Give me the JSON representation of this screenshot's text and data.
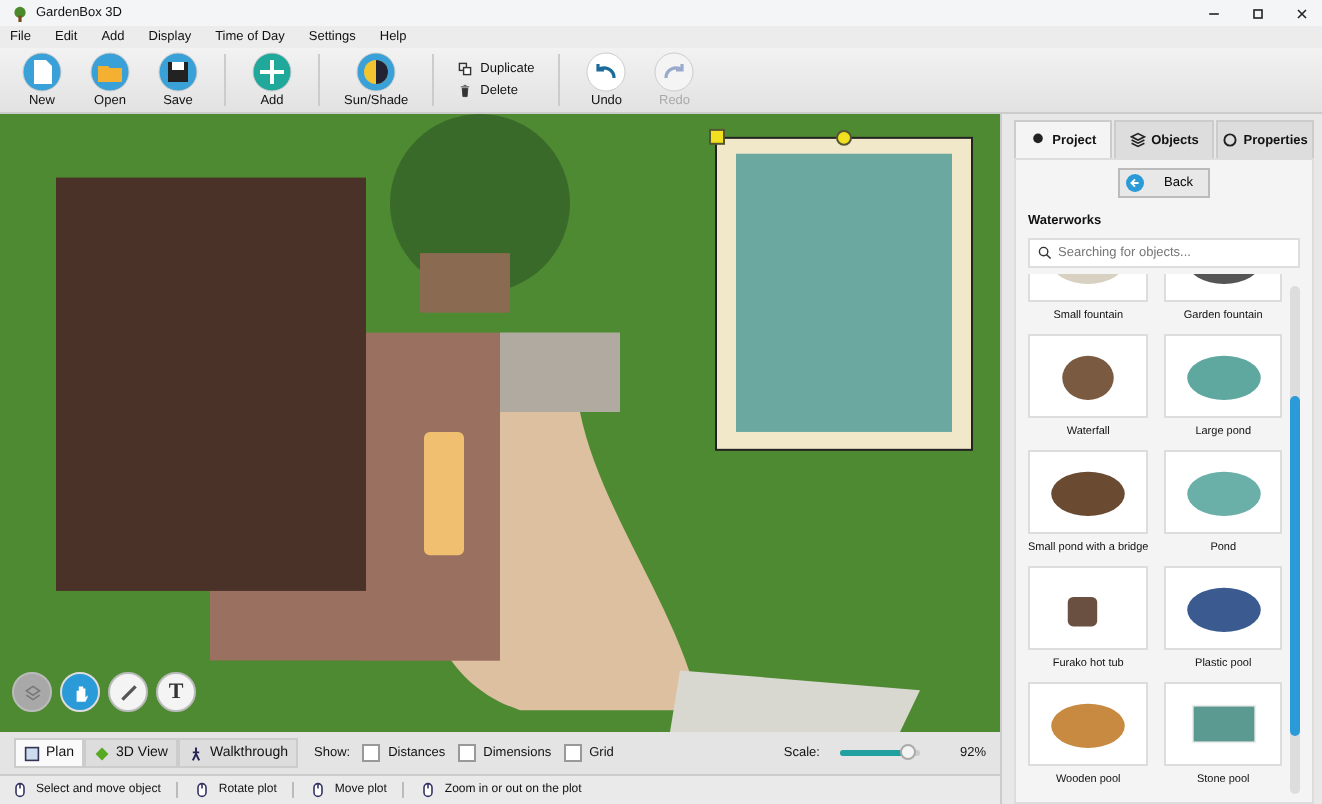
{
  "window": {
    "title": "GardenBox 3D"
  },
  "menu": [
    "File",
    "Edit",
    "Add",
    "Display",
    "Time of Day",
    "Settings",
    "Help"
  ],
  "toolbar": [
    {
      "kind": "new",
      "label": "New",
      "disabled": false
    },
    {
      "kind": "open",
      "label": "Open",
      "disabled": false
    },
    {
      "kind": "save",
      "label": "Save",
      "disabled": false
    },
    {
      "kind": "sep"
    },
    {
      "kind": "add",
      "label": "Add",
      "disabled": false
    },
    {
      "kind": "sep"
    },
    {
      "kind": "sun",
      "label": "Sun/Shade",
      "disabled": false
    },
    {
      "kind": "sep"
    },
    {
      "kind": "edit",
      "items": [
        {
          "kind": "duplicate",
          "label": "Duplicate"
        },
        {
          "kind": "delete",
          "label": "Delete"
        }
      ]
    },
    {
      "kind": "sep"
    },
    {
      "kind": "undo",
      "label": "Undo",
      "disabled": false
    },
    {
      "kind": "redo",
      "label": "Redo",
      "disabled": true
    }
  ],
  "map_tools": [
    {
      "kind": "layers",
      "selected": false,
      "disabled": true
    },
    {
      "kind": "hand",
      "selected": true,
      "disabled": false
    },
    {
      "kind": "ruler",
      "selected": false,
      "disabled": false
    },
    {
      "kind": "text",
      "selected": false,
      "disabled": false
    }
  ],
  "text_tool_glyph": "T",
  "view_tabs": [
    {
      "kind": "plan",
      "label": "Plan",
      "selected": true
    },
    {
      "kind": "perspective",
      "label": "3D View",
      "selected": false
    },
    {
      "kind": "walk",
      "label": "Walkthrough",
      "selected": false
    }
  ],
  "show": {
    "label": "Show:",
    "options": [
      {
        "label": "Distances",
        "checked": false
      },
      {
        "label": "Dimensions",
        "checked": false
      },
      {
        "label": "Grid",
        "checked": false
      }
    ]
  },
  "scale": {
    "label": "Scale:",
    "level": 0.86,
    "reading": "92%"
  },
  "status_bar": [
    "Select and move object",
    "Rotate plot",
    "Move plot",
    "Zoom in or out on the plot"
  ],
  "panel": {
    "tabs": [
      {
        "kind": "project",
        "label": "Project",
        "selected": true
      },
      {
        "kind": "objects",
        "label": "Objects",
        "selected": false
      },
      {
        "kind": "properties",
        "label": "Properties",
        "selected": false
      }
    ],
    "back": "Back",
    "section": "Waterworks",
    "search": {
      "placeholder": "Searching for objects..."
    },
    "objects": [
      {
        "kind": "fountain",
        "label": "Small fountain"
      },
      {
        "kind": "fountain2",
        "label": "Garden fountain"
      },
      {
        "kind": "rock",
        "label": "Waterfall"
      },
      {
        "kind": "pond",
        "label": "Large pond"
      },
      {
        "kind": "bridge",
        "label": "Small pond with a bridge"
      },
      {
        "kind": "oval",
        "label": "Pond"
      },
      {
        "kind": "tub",
        "label": "Furako hot tub"
      },
      {
        "kind": "round",
        "label": "Plastic pool"
      },
      {
        "kind": "wooden",
        "label": "Wooden pool"
      },
      {
        "kind": "rect",
        "label": "Stone pool"
      }
    ]
  }
}
